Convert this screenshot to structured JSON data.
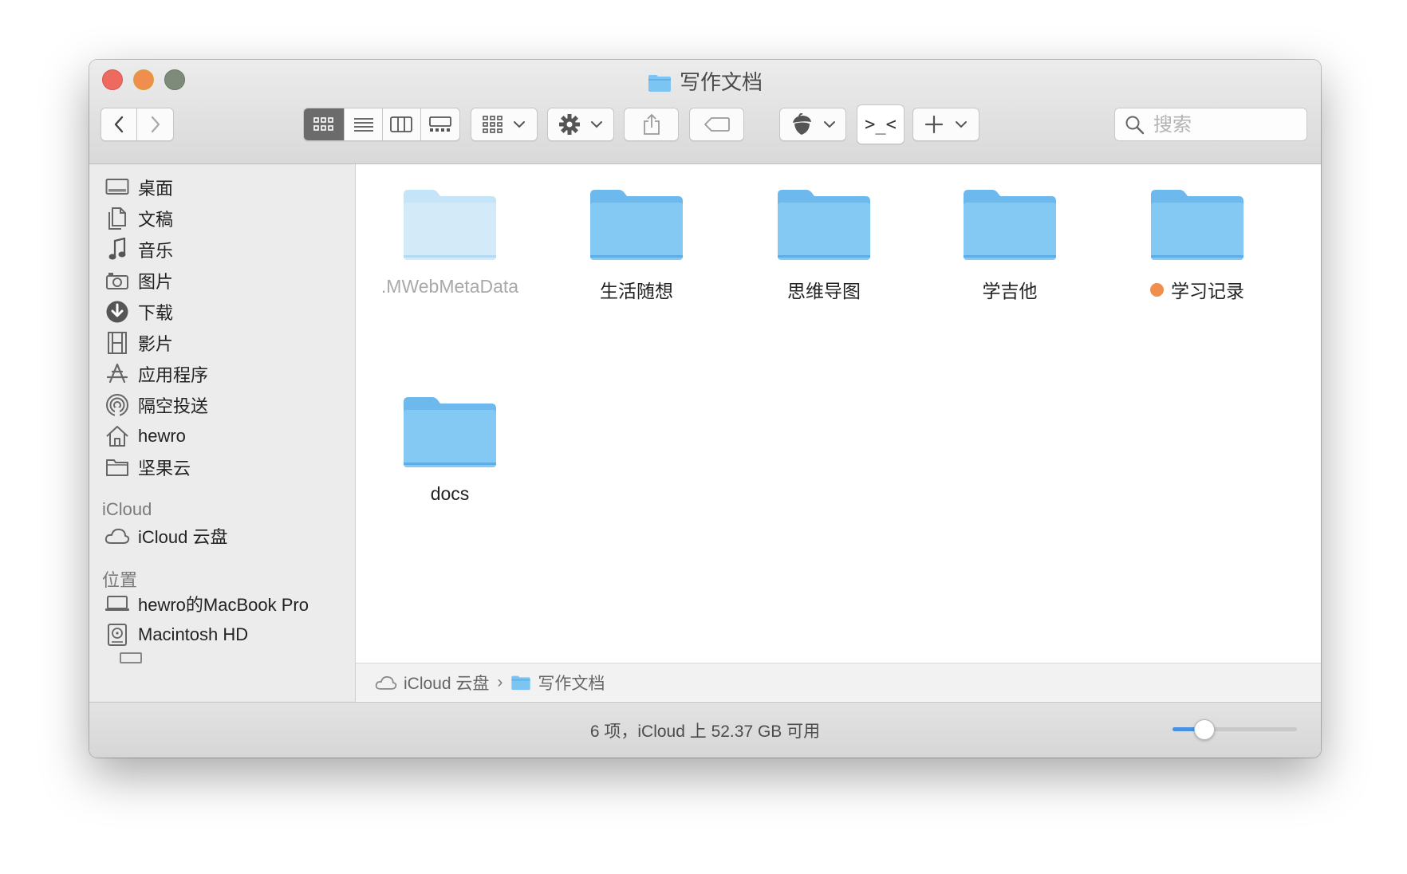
{
  "window": {
    "title": "写作文档"
  },
  "toolbar": {
    "back_icon": "chevron-left-icon",
    "forward_icon": "chevron-right-icon",
    "view_modes": [
      "icon-view",
      "list-view",
      "column-view",
      "gallery-view"
    ],
    "active_view": "icon-view",
    "group_icon": "group-grid-icon",
    "action_icon": "gear-icon",
    "share_icon": "share-icon",
    "tag_icon": "tag-icon",
    "app_icon": "acorn-icon",
    "terminal_label": ">_<",
    "add_icon": "plus-icon",
    "search_placeholder": "搜索"
  },
  "sidebar": {
    "favorites": [
      {
        "label": "桌面",
        "icon": "desktop-icon"
      },
      {
        "label": "文稿",
        "icon": "documents-icon"
      },
      {
        "label": "音乐",
        "icon": "music-note-icon"
      },
      {
        "label": "图片",
        "icon": "camera-icon"
      },
      {
        "label": "下载",
        "icon": "download-icon"
      },
      {
        "label": "影片",
        "icon": "film-icon"
      },
      {
        "label": "应用程序",
        "icon": "applications-icon"
      },
      {
        "label": "隔空投送",
        "icon": "airdrop-icon"
      },
      {
        "label": "hewro",
        "icon": "home-icon"
      },
      {
        "label": "坚果云",
        "icon": "folder-icon"
      }
    ],
    "icloud_header": "iCloud",
    "icloud_items": [
      {
        "label": "iCloud 云盘",
        "icon": "cloud-icon"
      }
    ],
    "locations_header": "位置",
    "locations": [
      {
        "label": "hewro的MacBook Pro",
        "icon": "laptop-icon"
      },
      {
        "label": "Macintosh HD",
        "icon": "hard-drive-icon"
      }
    ]
  },
  "files": [
    {
      "name": ".MWebMetaData",
      "dimmed": true,
      "tag": ""
    },
    {
      "name": "生活随想",
      "dimmed": false,
      "tag": ""
    },
    {
      "name": "思维导图",
      "dimmed": false,
      "tag": ""
    },
    {
      "name": "学吉他",
      "dimmed": false,
      "tag": ""
    },
    {
      "name": "学习记录",
      "dimmed": false,
      "tag": "orange"
    },
    {
      "name": "docs",
      "dimmed": false,
      "tag": ""
    }
  ],
  "pathbar": {
    "root": "iCloud 云盘",
    "current": "写作文档",
    "separator": "›"
  },
  "status": {
    "text": "6 项，iCloud 上 52.37 GB 可用",
    "icon_size_level": 0.25
  },
  "colors": {
    "folder": "#7cc4f2",
    "folder_dim": "#c5e4f7",
    "orange_tag": "#ef8e4d",
    "accent": "#4a90e2"
  }
}
